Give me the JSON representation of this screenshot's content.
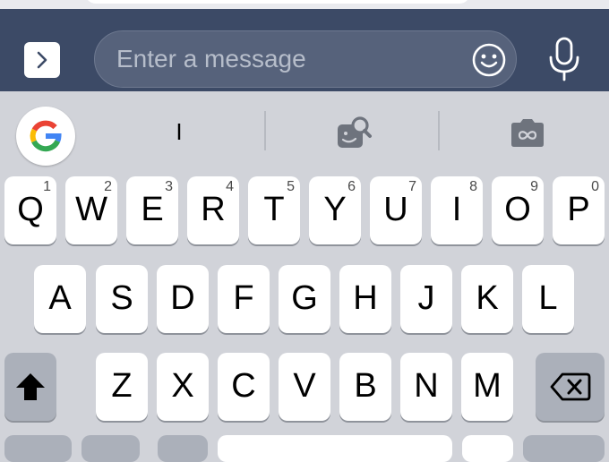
{
  "compose": {
    "message_placeholder": "Enter a message",
    "icons": {
      "expand": "chevron-right-icon",
      "emoji": "smiley-icon",
      "mic": "microphone-icon"
    }
  },
  "suggestions": {
    "google_icon": "google-g-logo",
    "suggested_word": "I",
    "sticker_icon": "sticker-search-icon",
    "gif_icon": "gif-camera-icon"
  },
  "keyboard": {
    "row1": [
      {
        "letter": "Q",
        "hint": "1"
      },
      {
        "letter": "W",
        "hint": "2"
      },
      {
        "letter": "E",
        "hint": "3"
      },
      {
        "letter": "R",
        "hint": "4"
      },
      {
        "letter": "T",
        "hint": "5"
      },
      {
        "letter": "Y",
        "hint": "6"
      },
      {
        "letter": "U",
        "hint": "7"
      },
      {
        "letter": "I",
        "hint": "8"
      },
      {
        "letter": "O",
        "hint": "9"
      },
      {
        "letter": "P",
        "hint": "0"
      }
    ],
    "row2": [
      {
        "letter": "A"
      },
      {
        "letter": "S"
      },
      {
        "letter": "D"
      },
      {
        "letter": "F"
      },
      {
        "letter": "G"
      },
      {
        "letter": "H"
      },
      {
        "letter": "J"
      },
      {
        "letter": "K"
      },
      {
        "letter": "L"
      }
    ],
    "row3": [
      {
        "letter": "Z"
      },
      {
        "letter": "X"
      },
      {
        "letter": "C"
      },
      {
        "letter": "V"
      },
      {
        "letter": "B"
      },
      {
        "letter": "N"
      },
      {
        "letter": "M"
      }
    ],
    "shift_icon": "shift-icon",
    "backspace_icon": "backspace-icon"
  },
  "colors": {
    "compose_bar": "#3c4a66",
    "keyboard_bg": "#d1d3d9",
    "key": "#ffffff",
    "special_key": "#abb0ba"
  }
}
